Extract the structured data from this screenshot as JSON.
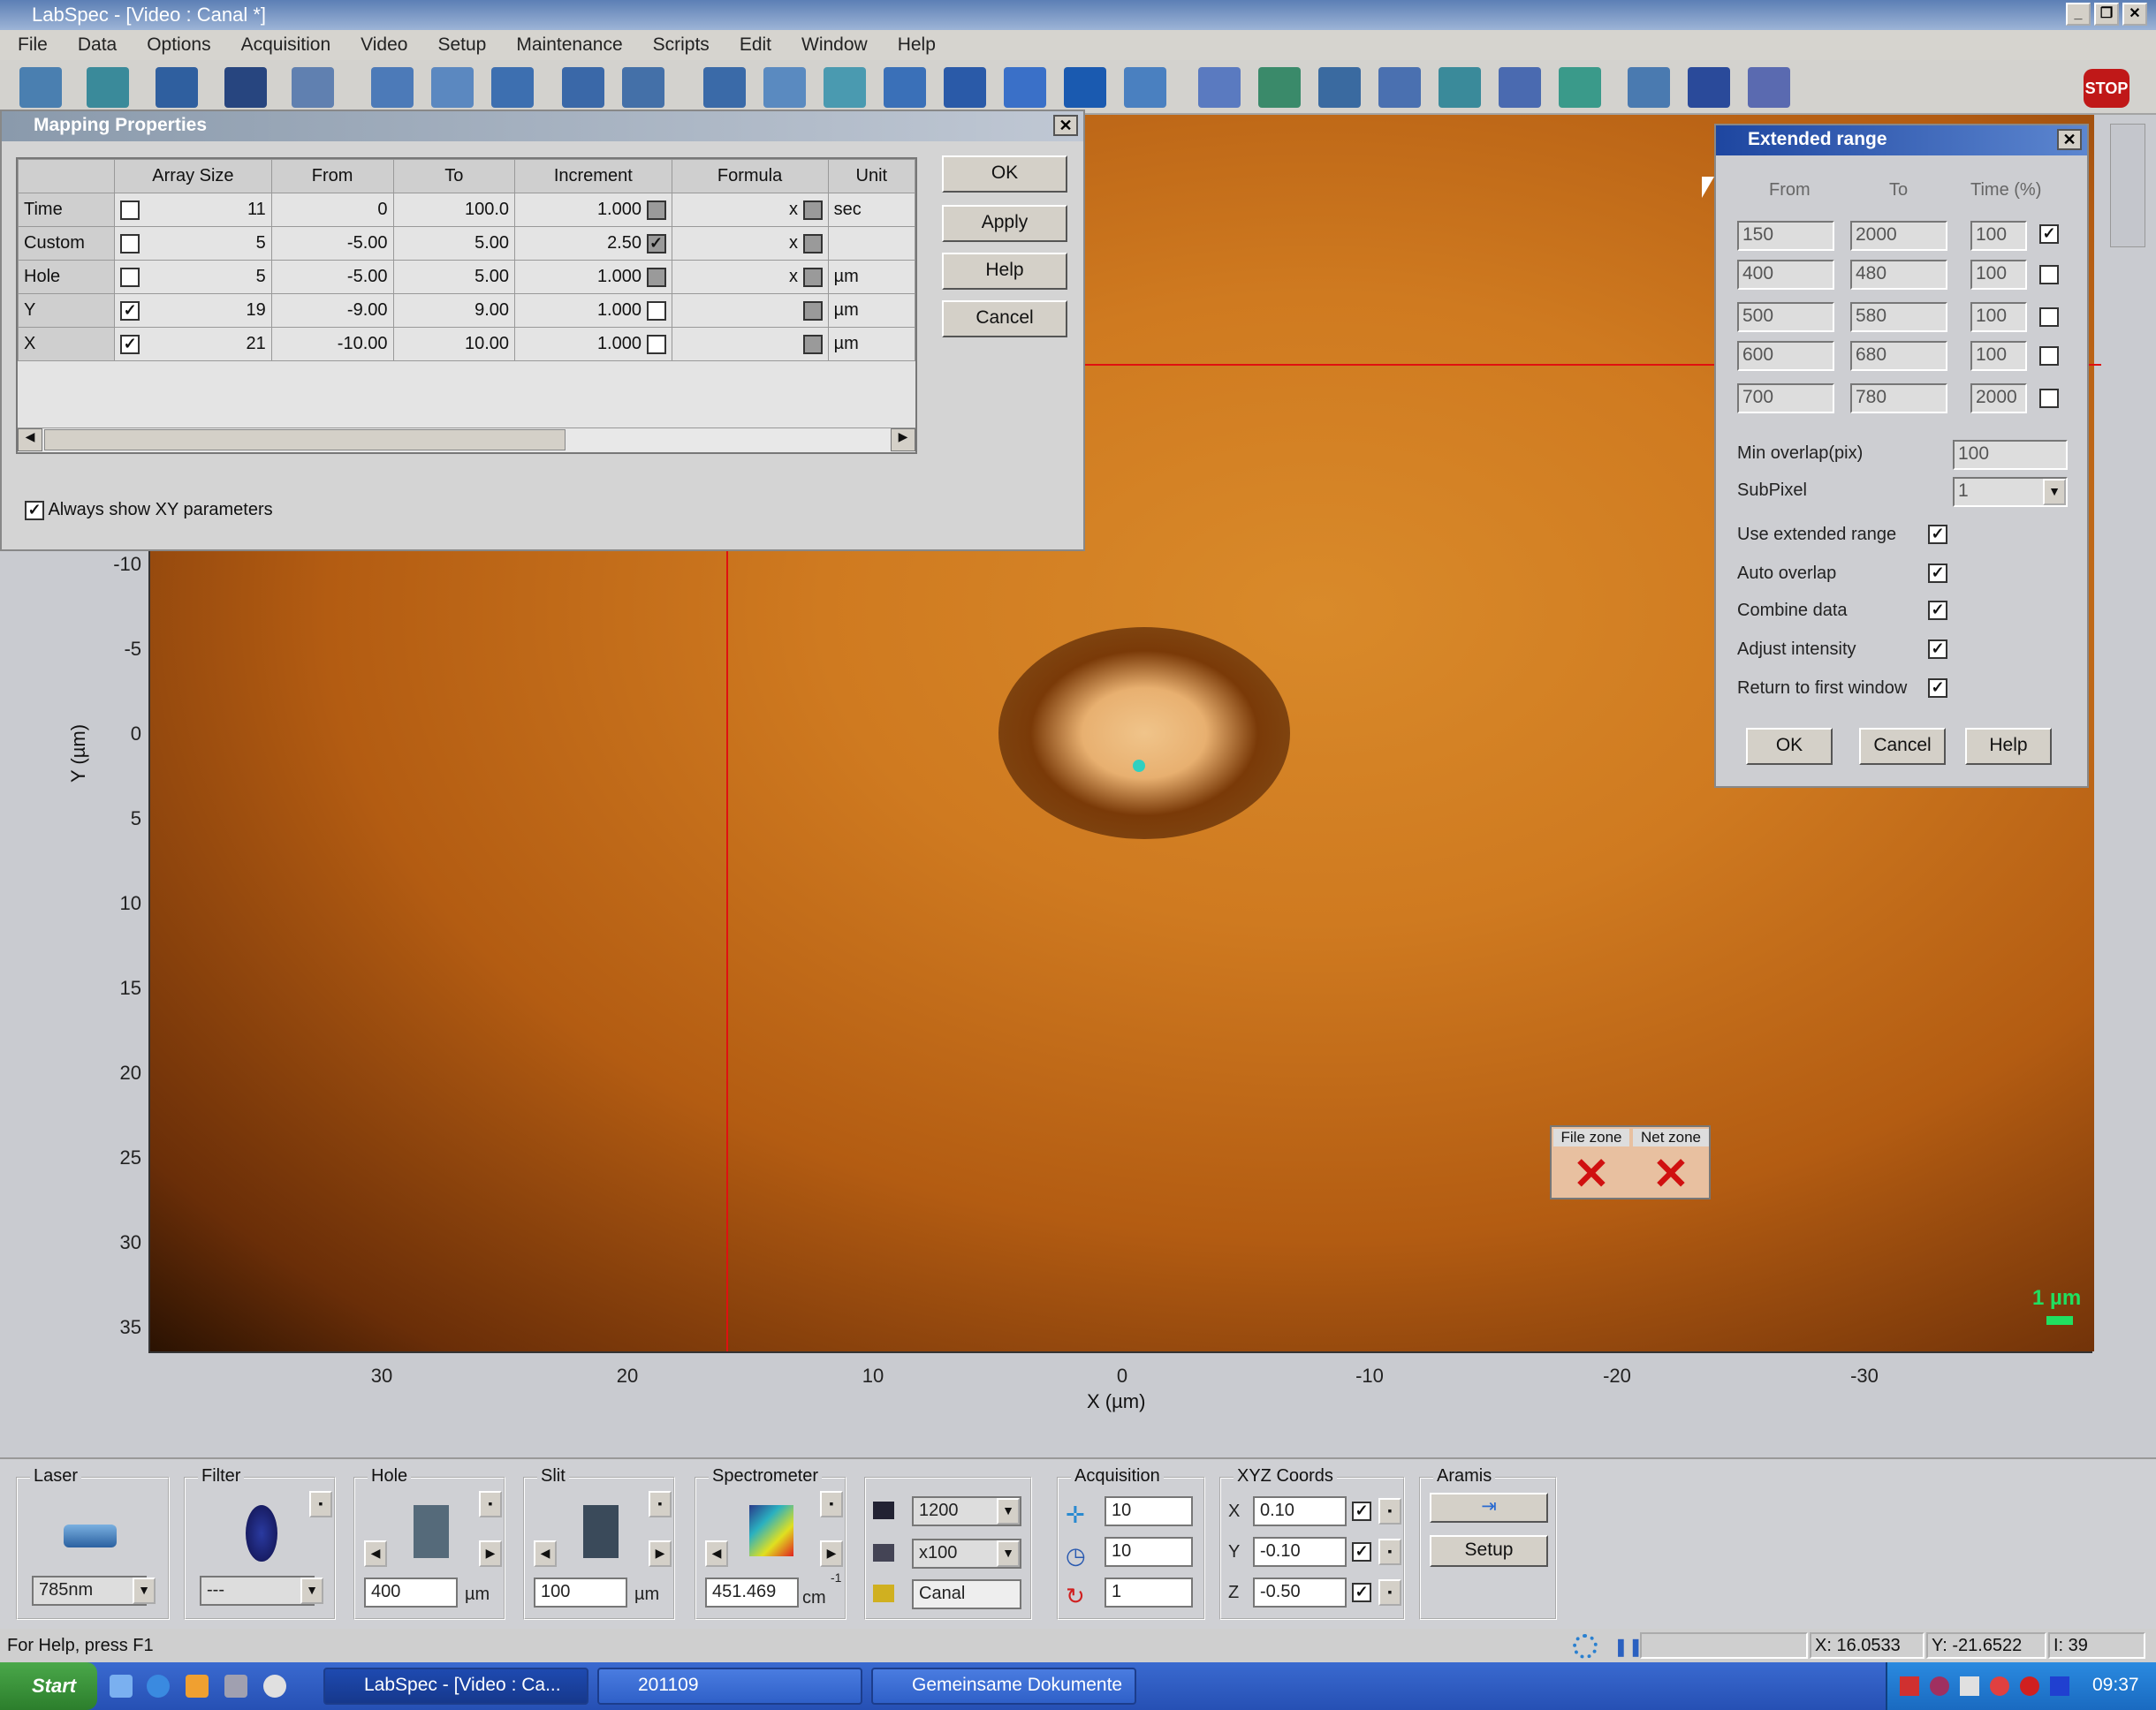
{
  "app": {
    "title": "LabSpec - [Video : Canal *]"
  },
  "menu": [
    "File",
    "Data",
    "Options",
    "Acquisition",
    "Video",
    "Setup",
    "Maintenance",
    "Scripts",
    "Edit",
    "Window",
    "Help"
  ],
  "toolbar": {
    "stop_label": "STOP"
  },
  "image": {
    "y_axis_label": "Y (µm)",
    "x_axis_label": "X (µm)",
    "y_ticks": [
      "-10",
      "-5",
      "0",
      "5",
      "10",
      "15",
      "20",
      "25",
      "30",
      "35"
    ],
    "x_ticks": [
      "30",
      "20",
      "10",
      "0",
      "-10",
      "-20",
      "-30"
    ],
    "scale_bar": "1 µm",
    "file_zone": "File zone",
    "net_zone": "Net zone"
  },
  "mapping": {
    "title": "Mapping Properties",
    "columns": [
      "Array Size",
      "From",
      "To",
      "Increment",
      "Formula",
      "Unit"
    ],
    "rows": [
      {
        "name": "Time",
        "checked": false,
        "size": "11",
        "from": "0",
        "to": "100.0",
        "inc": "1.000",
        "inc_checked": false,
        "formula": "x",
        "unit": "sec"
      },
      {
        "name": "Custom",
        "checked": false,
        "size": "5",
        "from": "-5.00",
        "to": "5.00",
        "inc": "2.50",
        "inc_checked": true,
        "formula": "x",
        "unit": ""
      },
      {
        "name": "Hole",
        "checked": false,
        "size": "5",
        "from": "-5.00",
        "to": "5.00",
        "inc": "1.000",
        "inc_checked": false,
        "formula": "x",
        "unit": "µm"
      },
      {
        "name": "Y",
        "checked": true,
        "size": "19",
        "from": "-9.00",
        "to": "9.00",
        "inc": "1.000",
        "inc_checked": false,
        "formula": "",
        "unit": "µm"
      },
      {
        "name": "X",
        "checked": true,
        "size": "21",
        "from": "-10.00",
        "to": "10.00",
        "inc": "1.000",
        "inc_checked": false,
        "formula": "",
        "unit": "µm"
      }
    ],
    "ok": "OK",
    "apply": "Apply",
    "help": "Help",
    "cancel": "Cancel",
    "always_show": "Always show XY parameters"
  },
  "extended": {
    "title": "Extended range",
    "col_from": "From",
    "col_to": "To",
    "col_time": "Time (%)",
    "rows": [
      {
        "from": "150",
        "to": "2000",
        "time": "100",
        "checked": true
      },
      {
        "from": "400",
        "to": "480",
        "time": "100",
        "checked": false
      },
      {
        "from": "500",
        "to": "580",
        "time": "100",
        "checked": false
      },
      {
        "from": "600",
        "to": "680",
        "time": "100",
        "checked": false
      },
      {
        "from": "700",
        "to": "780",
        "time": "2000",
        "checked": false
      }
    ],
    "min_overlap_label": "Min overlap(pix)",
    "min_overlap": "100",
    "subpixel_label": "SubPixel",
    "subpixel": "1",
    "options": [
      "Use extended range",
      "Auto overlap",
      "Combine data",
      "Adjust intensity",
      "Return to first window"
    ],
    "ok": "OK",
    "cancel": "Cancel",
    "help": "Help"
  },
  "bottom": {
    "laser": {
      "title": "Laser",
      "value": "785nm"
    },
    "filter": {
      "title": "Filter",
      "value": "---"
    },
    "hole": {
      "title": "Hole",
      "value": "400",
      "unit": "µm"
    },
    "slit": {
      "title": "Slit",
      "value": "100",
      "unit": "µm"
    },
    "spectrometer": {
      "title": "Spectrometer",
      "value": "451.469",
      "unit": "cm",
      "unit_sup": "-1"
    },
    "grating": "1200",
    "objective": "x100",
    "sample": "Canal",
    "acquisition": {
      "title": "Acquisition",
      "v1": "10",
      "v2": "10",
      "v3": "1"
    },
    "xyz": {
      "title": "XYZ Coords",
      "x_label": "X",
      "x": "0.10",
      "y_label": "Y",
      "y": "-0.10",
      "z_label": "Z",
      "z": "-0.50"
    },
    "aramis": {
      "title": "Aramis",
      "setup": "Setup"
    }
  },
  "status": {
    "help": "For Help, press F1",
    "x": "X: 16.0533",
    "y": "Y: -21.6522",
    "i": "I: 39"
  },
  "taskbar": {
    "start": "Start",
    "tasks": [
      "LabSpec - [Video : Ca...",
      "201109",
      "Gemeinsame Dokumente"
    ],
    "clock": "09:37"
  }
}
